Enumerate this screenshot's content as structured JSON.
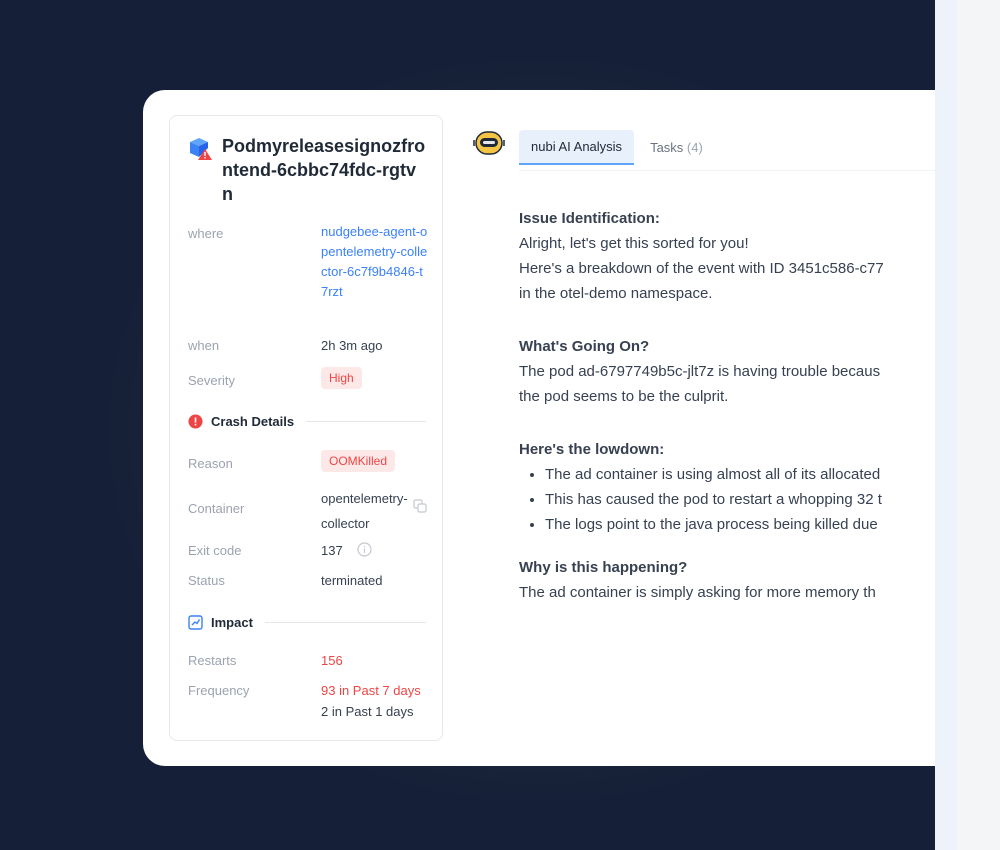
{
  "pod": {
    "title": "Podmyreleasesignozfrontend-6cbbc74fdc-rgtvn",
    "where_label": "where",
    "where_value": "nudgebee-agent-opentelemetry-collector-6c7f9b4846-t7rzt",
    "when_label": "when",
    "when_value": "2h 3m ago",
    "severity_label": "Severity",
    "severity_value": "High"
  },
  "crash": {
    "section_title": "Crash Details",
    "reason_label": "Reason",
    "reason_value": "OOMKilled",
    "container_label": "Container",
    "container_value": "opentelemetry-collector",
    "exit_label": "Exit code",
    "exit_value": "137",
    "status_label": "Status",
    "status_value": "terminated"
  },
  "impact": {
    "section_title": "Impact",
    "restarts_label": "Restarts",
    "restarts_value": "156",
    "frequency_label": "Frequency",
    "frequency_1": "93 in Past 7 days",
    "frequency_2": "2 in Past 1 days"
  },
  "tabs": {
    "analysis": "nubi AI Analysis",
    "tasks": "Tasks",
    "tasks_count": "(4)"
  },
  "analysis": {
    "issue_heading": "Issue Identification:",
    "intro_1": "Alright, let's get this sorted for you!",
    "intro_2": "Here's a breakdown of the event with ID 3451c586-c77",
    "intro_3": "in the otel-demo namespace.",
    "going_heading": "What's Going On?",
    "going_1": "The pod ad-6797749b5c-jlt7z is having trouble becaus",
    "going_2": "the pod seems to be the culprit.",
    "lowdown_heading": "Here's the lowdown:",
    "bullets": [
      "The ad container is using almost all of its allocated",
      "This has caused the pod to restart a whopping 32 t",
      "The logs point to the java process being killed due"
    ],
    "why_heading": "Why is this happening?",
    "why_1": "The ad container is simply asking for more memory th"
  },
  "colors": {
    "background": "#152038",
    "accent_blue": "#3b82f6",
    "danger_red": "#ef4444"
  },
  "icons": [
    "pod-icon",
    "crash-alert-icon",
    "impact-icon",
    "copy-icon",
    "info-icon",
    "bot-icon"
  ]
}
